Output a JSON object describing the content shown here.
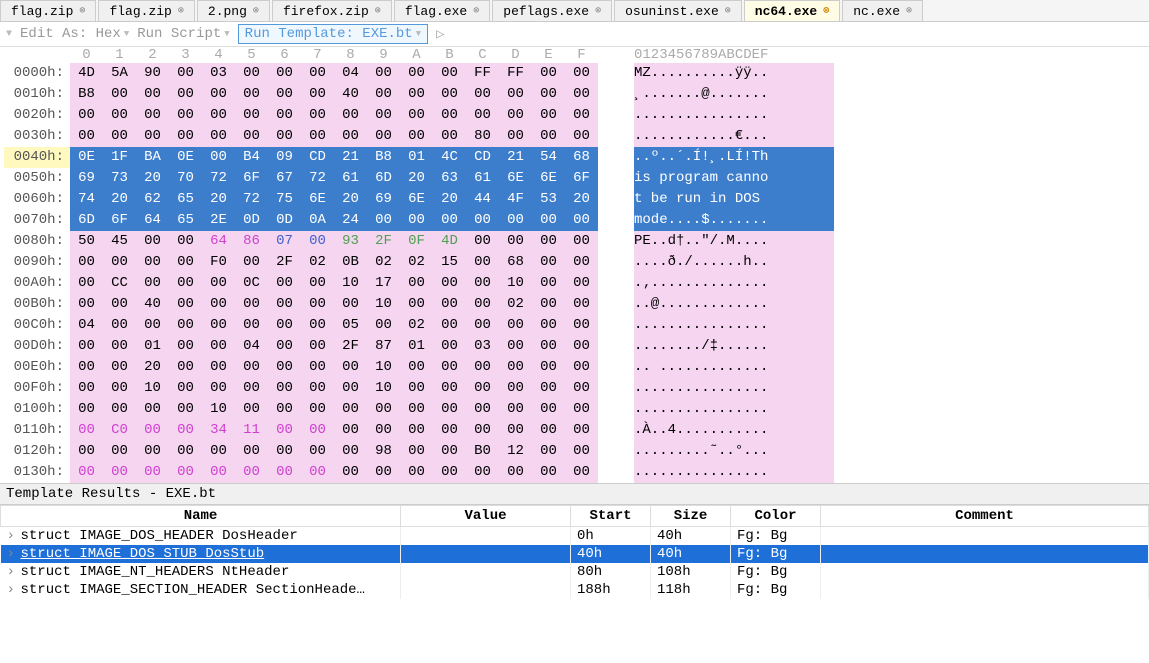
{
  "tabs": [
    {
      "label": "flag.zip",
      "active": false
    },
    {
      "label": "flag.zip",
      "active": false
    },
    {
      "label": "2.png",
      "active": false
    },
    {
      "label": "firefox.zip",
      "active": false
    },
    {
      "label": "flag.exe",
      "active": false
    },
    {
      "label": "peflags.exe",
      "active": false
    },
    {
      "label": "osuninst.exe",
      "active": false
    },
    {
      "label": "nc64.exe",
      "active": true,
      "special": true
    },
    {
      "label": "nc.exe",
      "active": false
    }
  ],
  "toolbar": {
    "edit_as": "Edit As: Hex",
    "run_script": "Run Script",
    "run_template": "Run Template: EXE.bt",
    "play_icon": "▷"
  },
  "hex_header_cols": [
    "0",
    "1",
    "2",
    "3",
    "4",
    "5",
    "6",
    "7",
    "8",
    "9",
    "A",
    "B",
    "C",
    "D",
    "E",
    "F"
  ],
  "hex_header_ascii": "0123456789ABCDEF",
  "hex_rows": [
    {
      "addr": "0000h:",
      "bytes": [
        "4D",
        "5A",
        "90",
        "00",
        "03",
        "00",
        "00",
        "00",
        "04",
        "00",
        "00",
        "00",
        "FF",
        "FF",
        "00",
        "00"
      ],
      "ascii": "MZ..........ÿÿ..",
      "style": "pink",
      "fg": [
        "",
        "",
        "",
        "",
        "",
        "",
        "",
        "",
        "",
        "",
        "",
        "",
        "",
        "",
        "",
        ""
      ]
    },
    {
      "addr": "0010h:",
      "bytes": [
        "B8",
        "00",
        "00",
        "00",
        "00",
        "00",
        "00",
        "00",
        "40",
        "00",
        "00",
        "00",
        "00",
        "00",
        "00",
        "00"
      ],
      "ascii": "¸.......@.......",
      "style": "pink"
    },
    {
      "addr": "0020h:",
      "bytes": [
        "00",
        "00",
        "00",
        "00",
        "00",
        "00",
        "00",
        "00",
        "00",
        "00",
        "00",
        "00",
        "00",
        "00",
        "00",
        "00"
      ],
      "ascii": "................",
      "style": "pink"
    },
    {
      "addr": "0030h:",
      "bytes": [
        "00",
        "00",
        "00",
        "00",
        "00",
        "00",
        "00",
        "00",
        "00",
        "00",
        "00",
        "00",
        "80",
        "00",
        "00",
        "00"
      ],
      "ascii": "............€...",
      "style": "pink"
    },
    {
      "addr": "0040h:",
      "bytes": [
        "0E",
        "1F",
        "BA",
        "0E",
        "00",
        "B4",
        "09",
        "CD",
        "21",
        "B8",
        "01",
        "4C",
        "CD",
        "21",
        "54",
        "68"
      ],
      "ascii": "..º..´.Í!¸.LÍ!Th",
      "style": "blue",
      "addrBg": "yellow"
    },
    {
      "addr": "0050h:",
      "bytes": [
        "69",
        "73",
        "20",
        "70",
        "72",
        "6F",
        "67",
        "72",
        "61",
        "6D",
        "20",
        "63",
        "61",
        "6E",
        "6E",
        "6F"
      ],
      "ascii": "is program canno",
      "style": "blue"
    },
    {
      "addr": "0060h:",
      "bytes": [
        "74",
        "20",
        "62",
        "65",
        "20",
        "72",
        "75",
        "6E",
        "20",
        "69",
        "6E",
        "20",
        "44",
        "4F",
        "53",
        "20"
      ],
      "ascii": "t be run in DOS ",
      "style": "blue"
    },
    {
      "addr": "0070h:",
      "bytes": [
        "6D",
        "6F",
        "64",
        "65",
        "2E",
        "0D",
        "0D",
        "0A",
        "24",
        "00",
        "00",
        "00",
        "00",
        "00",
        "00",
        "00"
      ],
      "ascii": "mode....$.......",
      "style": "blue"
    },
    {
      "addr": "0080h:",
      "bytes": [
        "50",
        "45",
        "00",
        "00",
        "64",
        "86",
        "07",
        "00",
        "93",
        "2F",
        "0F",
        "4D",
        "00",
        "00",
        "00",
        "00"
      ],
      "ascii": "PE..d†..\"/.M....",
      "style": "pink",
      "fg": [
        "",
        "",
        "",
        "",
        "m",
        "m",
        "b",
        "b",
        "g",
        "g",
        "g",
        "g",
        "",
        "",
        "",
        ""
      ]
    },
    {
      "addr": "0090h:",
      "bytes": [
        "00",
        "00",
        "00",
        "00",
        "F0",
        "00",
        "2F",
        "02",
        "0B",
        "02",
        "02",
        "15",
        "00",
        "68",
        "00",
        "00"
      ],
      "ascii": "....ð./......h..",
      "style": "pink"
    },
    {
      "addr": "00A0h:",
      "bytes": [
        "00",
        "CC",
        "00",
        "00",
        "00",
        "0C",
        "00",
        "00",
        "10",
        "17",
        "00",
        "00",
        "00",
        "10",
        "00",
        "00"
      ],
      "ascii": ".‚..............",
      "style": "pink"
    },
    {
      "addr": "00B0h:",
      "bytes": [
        "00",
        "00",
        "40",
        "00",
        "00",
        "00",
        "00",
        "00",
        "00",
        "10",
        "00",
        "00",
        "00",
        "02",
        "00",
        "00"
      ],
      "ascii": "..@.............",
      "style": "pink"
    },
    {
      "addr": "00C0h:",
      "bytes": [
        "04",
        "00",
        "00",
        "00",
        "00",
        "00",
        "00",
        "00",
        "05",
        "00",
        "02",
        "00",
        "00",
        "00",
        "00",
        "00"
      ],
      "ascii": "................",
      "style": "pink"
    },
    {
      "addr": "00D0h:",
      "bytes": [
        "00",
        "00",
        "01",
        "00",
        "00",
        "04",
        "00",
        "00",
        "2F",
        "87",
        "01",
        "00",
        "03",
        "00",
        "00",
        "00"
      ],
      "ascii": "......../‡......",
      "style": "pink"
    },
    {
      "addr": "00E0h:",
      "bytes": [
        "00",
        "00",
        "20",
        "00",
        "00",
        "00",
        "00",
        "00",
        "00",
        "10",
        "00",
        "00",
        "00",
        "00",
        "00",
        "00"
      ],
      "ascii": ".. .............",
      "style": "pink"
    },
    {
      "addr": "00F0h:",
      "bytes": [
        "00",
        "00",
        "10",
        "00",
        "00",
        "00",
        "00",
        "00",
        "00",
        "10",
        "00",
        "00",
        "00",
        "00",
        "00",
        "00"
      ],
      "ascii": "................",
      "style": "pink"
    },
    {
      "addr": "0100h:",
      "bytes": [
        "00",
        "00",
        "00",
        "00",
        "10",
        "00",
        "00",
        "00",
        "00",
        "00",
        "00",
        "00",
        "00",
        "00",
        "00",
        "00"
      ],
      "ascii": "................",
      "style": "pink"
    },
    {
      "addr": "0110h:",
      "bytes": [
        "00",
        "C0",
        "00",
        "00",
        "34",
        "11",
        "00",
        "00",
        "00",
        "00",
        "00",
        "00",
        "00",
        "00",
        "00",
        "00"
      ],
      "ascii": ".À..4...........",
      "style": "pink",
      "fg": [
        "m",
        "m",
        "m",
        "m",
        "m",
        "m",
        "m",
        "m",
        "",
        "",
        "",
        "",
        "",
        "",
        "",
        ""
      ]
    },
    {
      "addr": "0120h:",
      "bytes": [
        "00",
        "00",
        "00",
        "00",
        "00",
        "00",
        "00",
        "00",
        "00",
        "98",
        "00",
        "00",
        "B0",
        "12",
        "00",
        "00"
      ],
      "ascii": ".........˜..°...",
      "style": "pink"
    },
    {
      "addr": "0130h:",
      "bytes": [
        "00",
        "00",
        "00",
        "00",
        "00",
        "00",
        "00",
        "00",
        "00",
        "00",
        "00",
        "00",
        "00",
        "00",
        "00",
        "00"
      ],
      "ascii": "................",
      "style": "pink",
      "fg": [
        "m",
        "m",
        "m",
        "m",
        "m",
        "m",
        "m",
        "m",
        "",
        "",
        "",
        "",
        "",
        "",
        "",
        ""
      ]
    }
  ],
  "panel_title": "Template Results - EXE.bt",
  "table_headers": [
    "Name",
    "Value",
    "Start",
    "Size",
    "Color",
    "Comment"
  ],
  "table_rows": [
    {
      "name": "struct IMAGE_DOS_HEADER DosHeader",
      "value": "",
      "start": "0h",
      "size": "40h",
      "color": "Fg:   Bg",
      "selected": false
    },
    {
      "name": "struct IMAGE_DOS_STUB DosStub",
      "value": "",
      "start": "40h",
      "size": "40h",
      "color": "Fg:   Bg",
      "selected": true,
      "underline": true
    },
    {
      "name": "struct IMAGE_NT_HEADERS NtHeader",
      "value": "",
      "start": "80h",
      "size": "108h",
      "color": "Fg:   Bg",
      "selected": false
    },
    {
      "name": "struct IMAGE_SECTION_HEADER SectionHeade…",
      "value": "",
      "start": "188h",
      "size": "118h",
      "color": "Fg:   Bg",
      "selected": false
    }
  ]
}
